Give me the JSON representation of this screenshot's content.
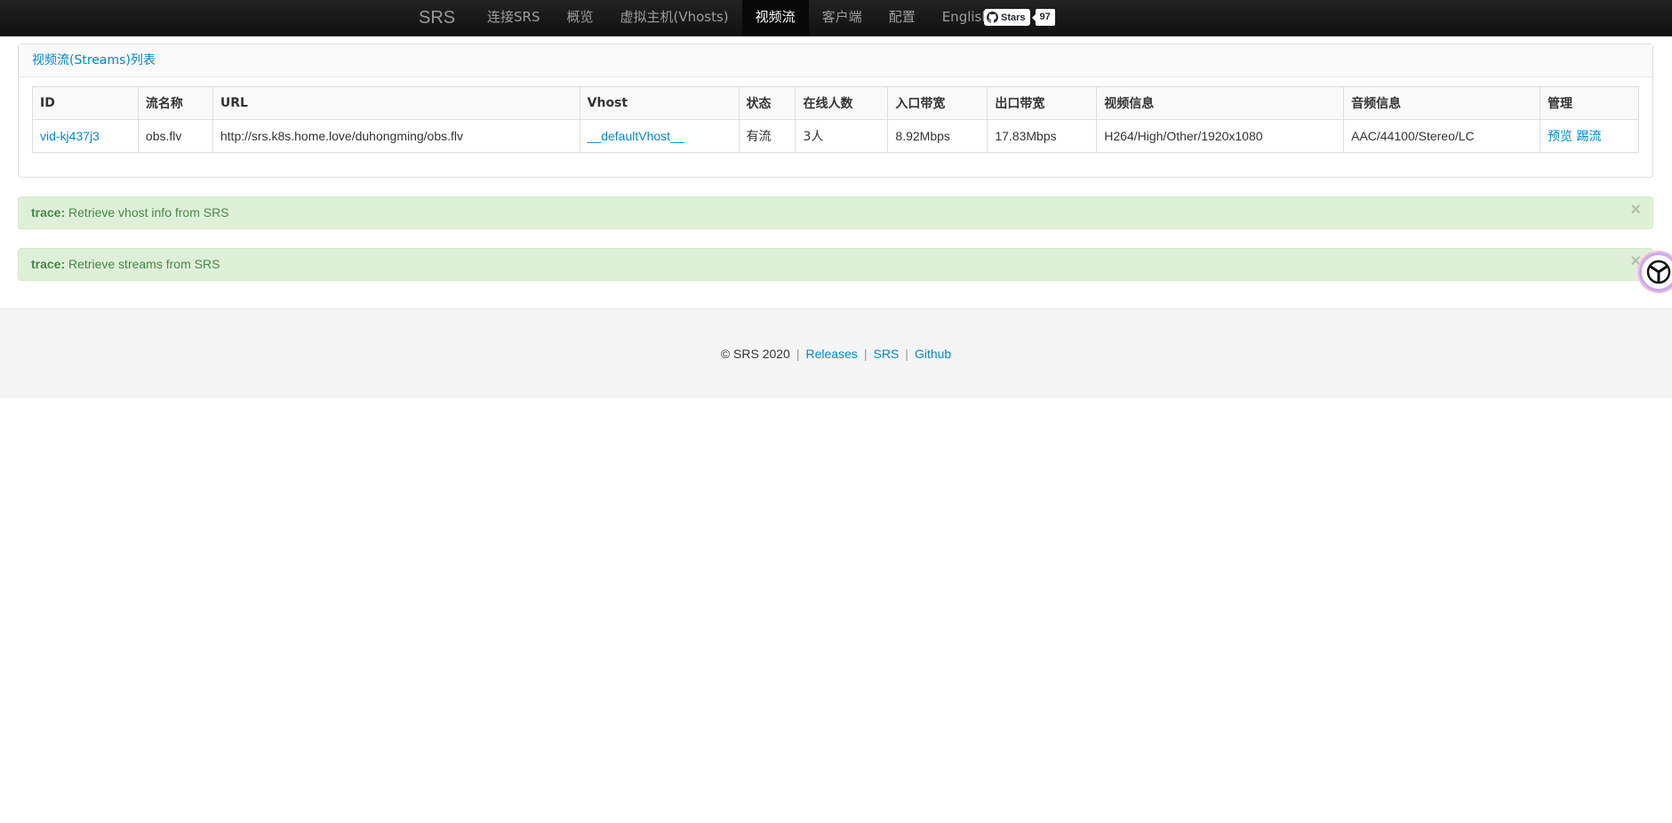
{
  "navbar": {
    "brand": "SRS",
    "items": [
      {
        "label": "连接SRS",
        "active": false
      },
      {
        "label": "概览",
        "active": false
      },
      {
        "label": "虚拟主机(Vhosts)",
        "active": false
      },
      {
        "label": "视频流",
        "active": true
      },
      {
        "label": "客户端",
        "active": false
      },
      {
        "label": "配置",
        "active": false
      },
      {
        "label": "English",
        "active": false
      }
    ],
    "github": {
      "label": "Stars",
      "count": "97",
      "icon": "github-icon"
    }
  },
  "panel": {
    "title": "视频流(Streams)列表",
    "columns": [
      "ID",
      "流名称",
      "URL",
      "Vhost",
      "状态",
      "在线人数",
      "入口带宽",
      "出口带宽",
      "视频信息",
      "音频信息",
      "管理"
    ],
    "rows": [
      {
        "id": "vid-kj437j3",
        "name": "obs.flv",
        "url": "http://srs.k8s.home.love/duhongming/obs.flv",
        "vhost": "__defaultVhost__",
        "status": "有流",
        "clients": "3人",
        "recv": "8.92Mbps",
        "send": "17.83Mbps",
        "video": "H264/High/Other/1920x1080",
        "audio": "AAC/44100/Stereo/LC",
        "action_preview": "预览",
        "action_kick": "踢流"
      }
    ]
  },
  "alerts": [
    {
      "level": "trace:",
      "message": "Retrieve vhost info from SRS",
      "close": "×"
    },
    {
      "level": "trace:",
      "message": "Retrieve streams from SRS",
      "close": "×"
    }
  ],
  "footer": {
    "copyright": "© SRS 2020",
    "sep": "|",
    "links": [
      "Releases",
      "SRS",
      "Github"
    ]
  },
  "colors": {
    "link": "#0088cc",
    "navbar_bg": "#1b1b1b",
    "alert_bg": "#dff0d8",
    "alert_text": "#468847"
  }
}
